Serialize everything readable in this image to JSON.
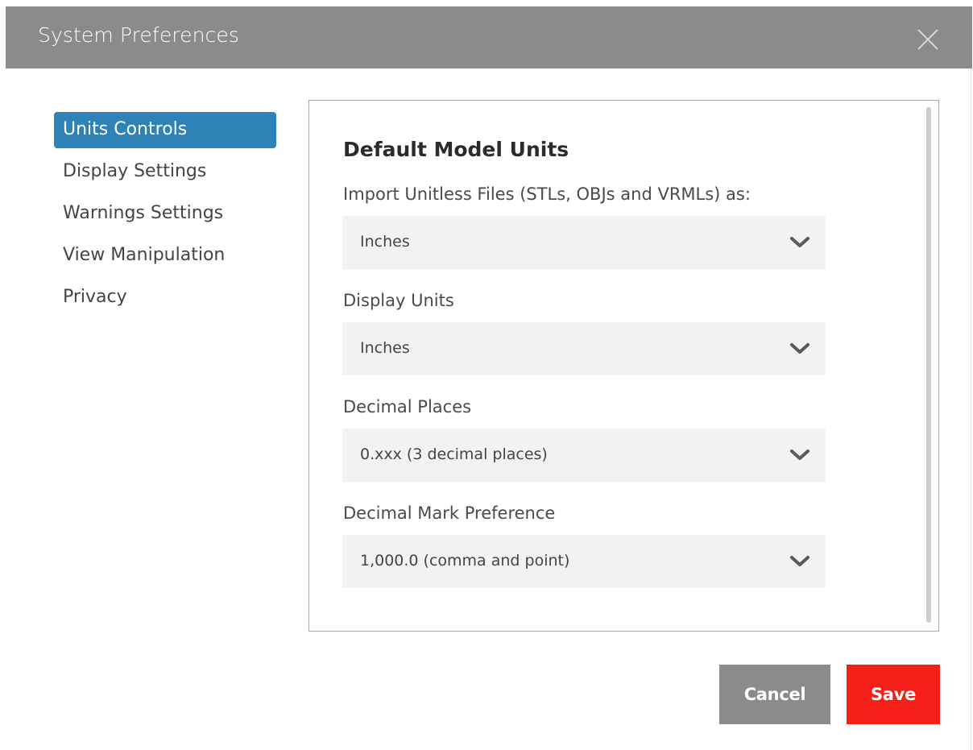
{
  "window": {
    "title": "System Preferences",
    "close_icon": "close-icon"
  },
  "sidebar": {
    "items": [
      {
        "label": "Units Controls",
        "active": true
      },
      {
        "label": "Display Settings",
        "active": false
      },
      {
        "label": "Warnings Settings",
        "active": false
      },
      {
        "label": "View Manipulation",
        "active": false
      },
      {
        "label": "Privacy",
        "active": false
      }
    ]
  },
  "main": {
    "section_title": "Default Model Units",
    "fields": [
      {
        "label": "Import Unitless Files (STLs, OBJs and VRMLs) as:",
        "value": "Inches"
      },
      {
        "label": "Display Units",
        "value": "Inches"
      },
      {
        "label": "Decimal Places",
        "value": "0.xxx (3 decimal places)"
      },
      {
        "label": "Decimal Mark Preference",
        "value": "1,000.0 (comma and point)"
      }
    ],
    "dropdown_icon": "chevron-down-icon"
  },
  "footer": {
    "cancel_label": "Cancel",
    "save_label": "Save"
  },
  "colors": {
    "titlebar": "#8b8b8b",
    "active_nav": "#2e82b5",
    "cancel_button": "#8b8b8b",
    "save_button": "#f41f17",
    "select_background": "#f2f2f2"
  }
}
